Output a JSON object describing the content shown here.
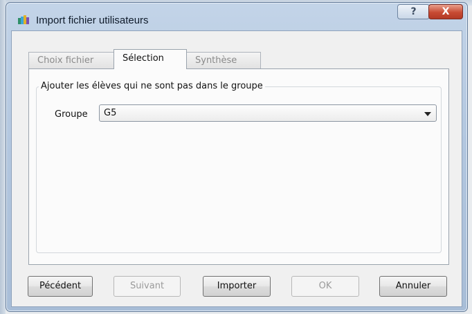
{
  "window": {
    "title": "Import fichier utilisateurs",
    "help_label": "?",
    "close_label": "X"
  },
  "tabs": [
    {
      "label": "Choix fichier",
      "active": false
    },
    {
      "label": "Sélection",
      "active": true
    },
    {
      "label": "Synthèse",
      "active": false
    }
  ],
  "selection": {
    "group_title": "Ajouter les élèves qui ne sont pas dans le groupe",
    "field_label": "Groupe",
    "group_value": "G5"
  },
  "buttons": {
    "previous": "Pécédent",
    "next": "Suivant",
    "import": "Importer",
    "ok": "OK",
    "cancel": "Annuler"
  }
}
